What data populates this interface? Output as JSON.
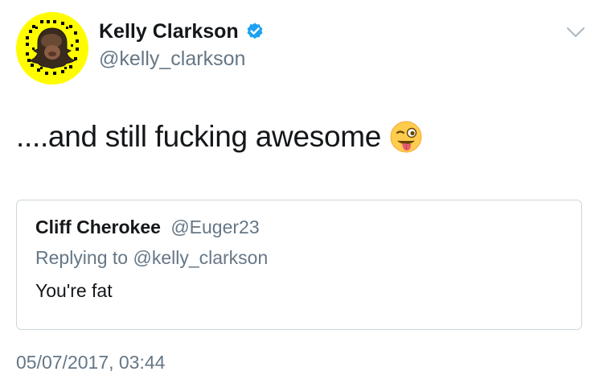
{
  "author": {
    "name": "Kelly Clarkson",
    "handle": "@kelly_clarkson",
    "verified": true,
    "avatar_icon": "snapchat-ghost-avatar-icon"
  },
  "tweet": {
    "text": "....and still fucking awesome",
    "emoji": "winking-face-with-tongue-icon"
  },
  "quoted_tweet": {
    "author_name": "Cliff Cherokee",
    "author_handle": "@Euger23",
    "reply_prefix": "Replying to",
    "reply_to": "@kelly_clarkson",
    "text": "You're fat"
  },
  "timestamp": "05/07/2017, 03:44",
  "colors": {
    "text_primary": "#14171a",
    "text_secondary": "#657786",
    "verified_blue": "#1da1f2",
    "border": "#ccd6dd",
    "snapchat_yellow": "#fffc00"
  }
}
